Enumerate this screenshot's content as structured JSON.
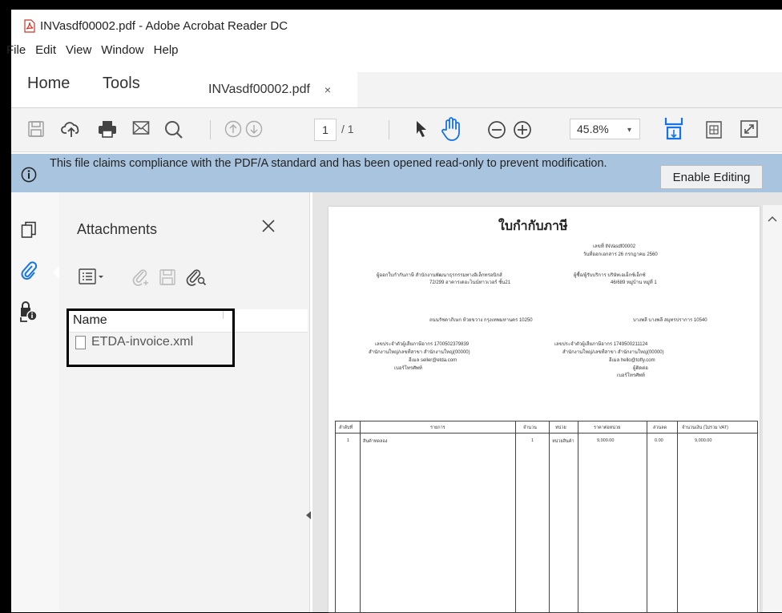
{
  "window": {
    "title": "INVasdf00002.pdf - Adobe Acrobat Reader DC"
  },
  "menu": [
    "File",
    "Edit",
    "View",
    "Window",
    "Help"
  ],
  "tabs": {
    "home": "Home",
    "tools": "Tools",
    "document": "INVasdf00002.pdf",
    "close_symbol": "×"
  },
  "toolbar": {
    "page_current": "1",
    "page_total": "/ 1",
    "zoom": "45.8%",
    "zoom_caret": "▾"
  },
  "banner": {
    "message": "This file claims compliance with the PDF/A standard and has been opened read-only to prevent modification.",
    "button": "Enable Editing"
  },
  "attachments": {
    "title": "Attachments",
    "column": "Name",
    "files": [
      "ETDA-invoice.xml"
    ]
  },
  "document": {
    "title": "ใบกำกับภาษี",
    "meta": [
      "เลขที่ INVasdf00002",
      "วันที่ออกเอกสาร 26 กรกฎาคม 2560"
    ],
    "seller_block": [
      "ผู้ออกใบกำกับภาษี สำนักงานพัฒนาธุรกรรมทางอิเล็กทรอนิกส์",
      "72/299 อาคารเดอะไนน์ทาวเวอร์ ชั้น21",
      "ถนนรัชดาภิเษก ห้วยขวาง กรุงเทพมหานคร 10250"
    ],
    "buyer_block": [
      "ผู้ซื้อ/ผู้รับบริการ บริษัทเอเอ็กซ์เอ็กซ์",
      "46/689 หมู่บ้าน หมู่ที่ 1",
      "บางพลี บางพลี สมุทรปราการ 10540"
    ],
    "seller_ids": [
      "เลขประจำตัวผู้เสียภาษีอากร 1700502379839",
      "สำนักงานใหญ่/เลขที่สาขา สำนักงานใหญ่(00000)",
      "อีเมล seller@etda.com",
      "เบอร์โทรศัพท์"
    ],
    "buyer_ids": [
      "เลขประจำตัวผู้เสียภาษีอากร 1749500211124",
      "สำนักงานใหญ่/เลขที่สาขา สำนักงานใหญ่(00000)",
      "อีเมล hello@tofty.com",
      "ผู้ติดต่อ",
      "เบอร์โทรศัพท์"
    ],
    "table": {
      "headers": [
        "ลำดับที่",
        "รายการ",
        "จำนวน",
        "หน่วย",
        "ราคาต่อหน่วย",
        "ส่วนลด",
        "จำนวนเงิน (ไม่รวม VAT)"
      ],
      "rows": [
        [
          "1",
          "สินค้าทดลอง",
          "1",
          "หน่วยสินค้า",
          "9,000.00",
          "0.00",
          "9,000.00"
        ]
      ]
    }
  }
}
